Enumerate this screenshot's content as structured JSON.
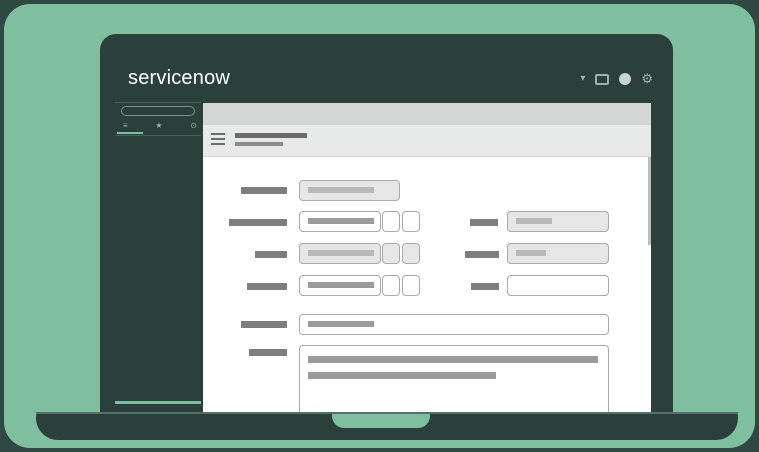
{
  "app": {
    "logo_text": "servicenow",
    "accent": "#7fbf9f",
    "background": "#2f4843",
    "frame": "#2b3f3c"
  },
  "header_icons": [
    "chevron-down-icon",
    "window-icon",
    "profile-dot-icon",
    "gear-icon"
  ],
  "nav": {
    "tabs": [
      "≡",
      "★",
      "⊙"
    ]
  }
}
